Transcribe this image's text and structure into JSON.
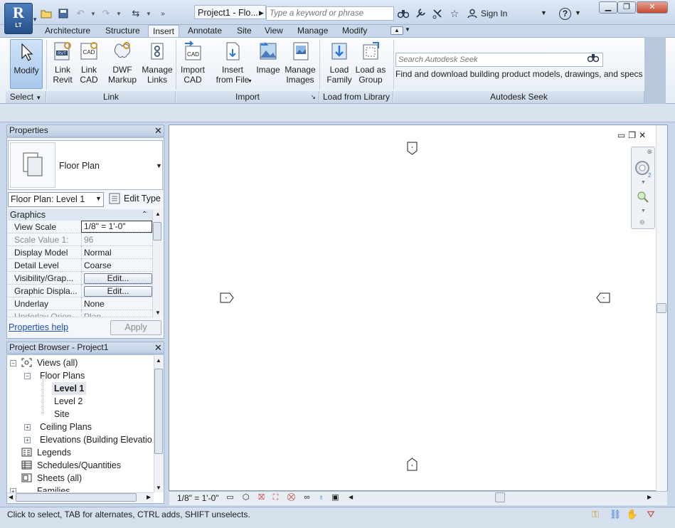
{
  "app": {
    "badge_big": "R",
    "badge_small": "LT",
    "title": "Project1 - Flo...",
    "search_placeholder": "Type a keyword or phrase",
    "sign_in": "Sign In"
  },
  "tabs": [
    {
      "label": "Architecture"
    },
    {
      "label": "Structure"
    },
    {
      "label": "Insert",
      "active": true
    },
    {
      "label": "Annotate"
    },
    {
      "label": "Site"
    },
    {
      "label": "View"
    },
    {
      "label": "Manage"
    },
    {
      "label": "Modify"
    }
  ],
  "ribbon": {
    "modify": "Modify",
    "link_revit_1": "Link",
    "link_revit_2": "Revit",
    "link_cad_1": "Link",
    "link_cad_2": "CAD",
    "dwf_1": "DWF",
    "dwf_2": "Markup",
    "manage_links_1": "Manage",
    "manage_links_2": "Links",
    "import_cad_1": "Import",
    "import_cad_2": "CAD",
    "insert_file_1": "Insert",
    "insert_file_2": "from File",
    "image": "Image",
    "manage_images_1": "Manage",
    "manage_images_2": "Images",
    "load_family_1": "Load",
    "load_family_2": "Family",
    "load_group_1": "Load as",
    "load_group_2": "Group",
    "seek_placeholder": "Search Autodesk Seek",
    "seek_desc": "Find and download building product models, drawings, and specs",
    "panels": {
      "select": "Select",
      "link": "Link",
      "import": "Import",
      "library": "Load from Library",
      "seek": "Autodesk Seek"
    }
  },
  "properties": {
    "title": "Properties",
    "type_name": "Floor Plan",
    "instance": "Floor Plan: Level 1",
    "edit_type": "Edit Type",
    "group": "Graphics",
    "rows": [
      {
        "name": "View Scale",
        "value": "1/8\" = 1'-0\""
      },
      {
        "name": "Scale Value    1:",
        "value": "96"
      },
      {
        "name": "Display Model",
        "value": "Normal"
      },
      {
        "name": "Detail Level",
        "value": "Coarse"
      },
      {
        "name": "Visibility/Grap...",
        "value": "Edit..."
      },
      {
        "name": "Graphic Displa...",
        "value": "Edit..."
      },
      {
        "name": "Underlay",
        "value": "None"
      },
      {
        "name": "Underlay Orien...",
        "value": "Plan"
      }
    ],
    "help": "Properties help",
    "apply": "Apply"
  },
  "browser": {
    "title": "Project Browser - Project1",
    "items": [
      {
        "label": "Views (all)"
      },
      {
        "label": "Floor Plans"
      },
      {
        "label": "Level 1"
      },
      {
        "label": "Level 2"
      },
      {
        "label": "Site"
      },
      {
        "label": "Ceiling Plans"
      },
      {
        "label": "Elevations (Building Elevation"
      },
      {
        "label": "Legends"
      },
      {
        "label": "Schedules/Quantities"
      },
      {
        "label": "Sheets (all)"
      },
      {
        "label": "Families"
      }
    ]
  },
  "viewbar": {
    "scale": "1/8\" = 1'-0\""
  },
  "status": {
    "text": "Click to select, TAB for alternates, CTRL adds, SHIFT unselects."
  }
}
